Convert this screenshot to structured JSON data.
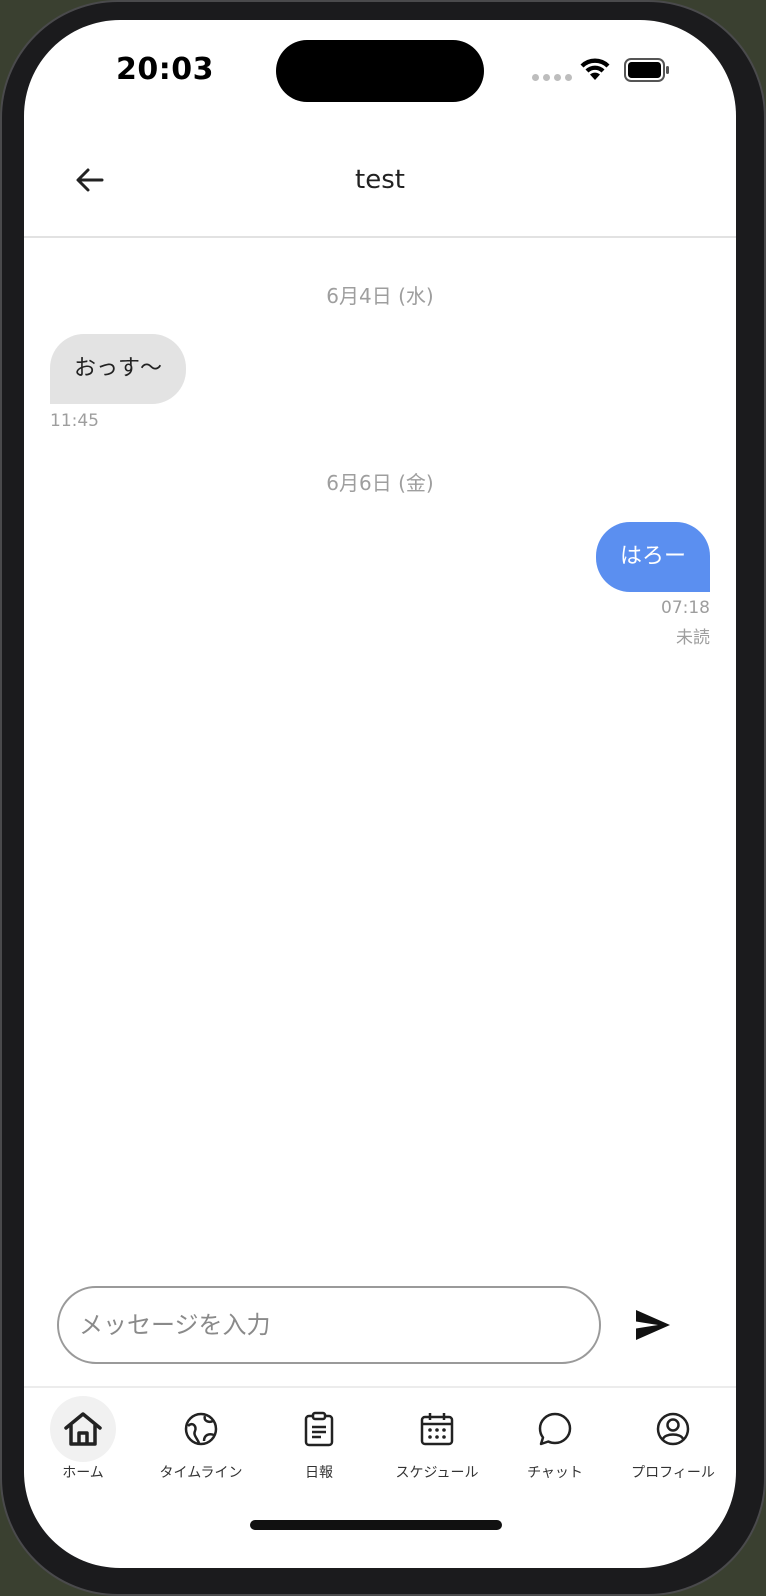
{
  "status_bar": {
    "time": "20:03"
  },
  "header": {
    "title": "test"
  },
  "messages": [
    {
      "date": "6月4日 (水)",
      "text": "おっす〜",
      "time": "11:45",
      "direction": "incoming"
    },
    {
      "date": "6月6日 (金)",
      "text": "はろー",
      "time": "07:18",
      "read_status": "未読",
      "direction": "outgoing"
    }
  ],
  "composer": {
    "placeholder": "メッセージを入力",
    "value": ""
  },
  "nav": {
    "items": [
      {
        "label": "ホーム",
        "icon": "home-icon",
        "active": true
      },
      {
        "label": "タイムライン",
        "icon": "globe-icon"
      },
      {
        "label": "日報",
        "icon": "clipboard-icon"
      },
      {
        "label": "スケジュール",
        "icon": "calendar-icon"
      },
      {
        "label": "チャット",
        "icon": "chat-bubble-icon"
      },
      {
        "label": "プロフィール",
        "icon": "profile-icon"
      }
    ]
  },
  "colors": {
    "outgoing_bubble": "#5b8ff0",
    "incoming_bubble": "#e3e3e3"
  }
}
